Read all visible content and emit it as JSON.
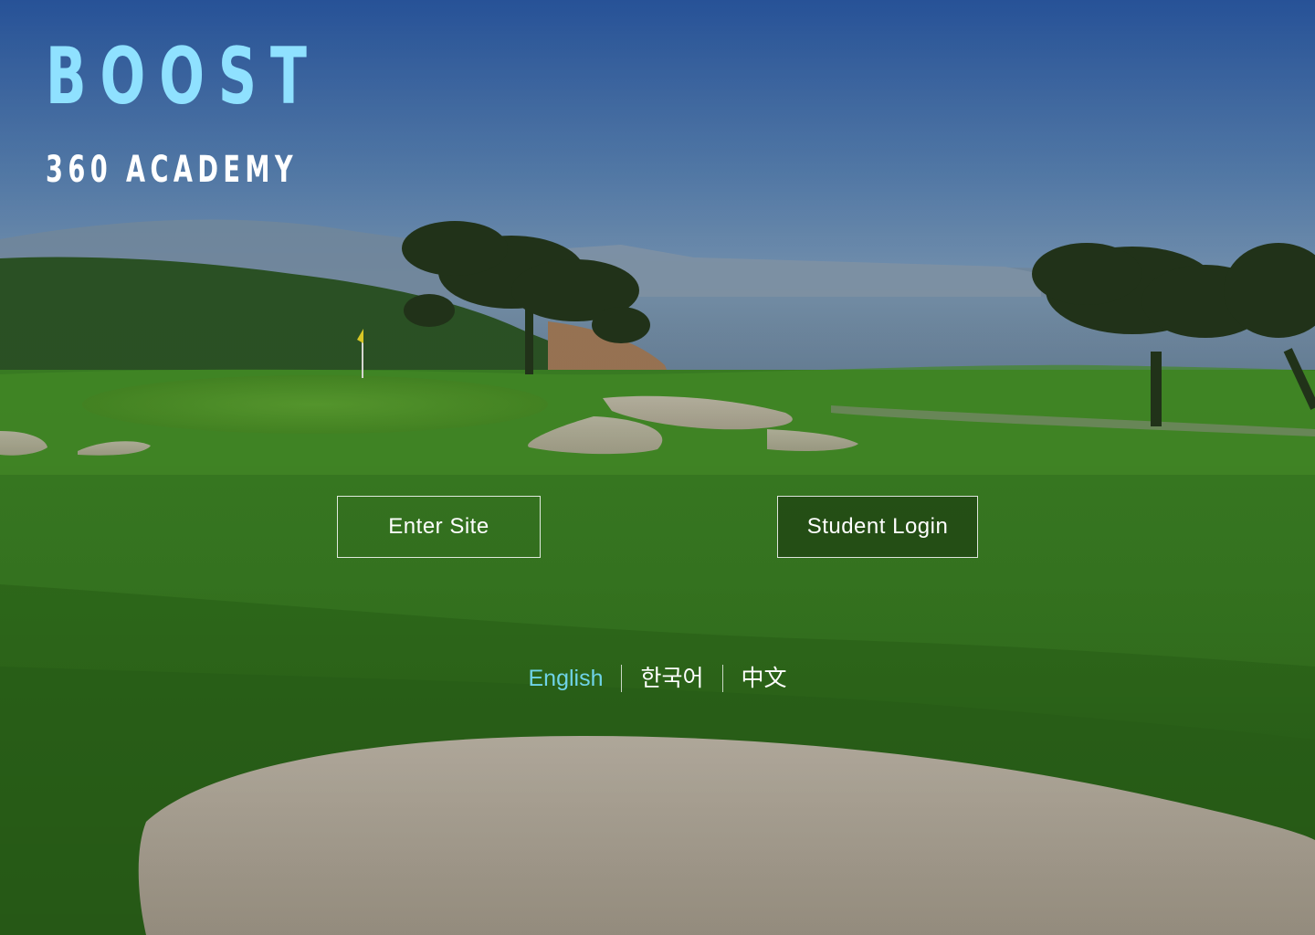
{
  "brand": {
    "title": "BOOST",
    "subtitle": "360 ACADEMY"
  },
  "buttons": {
    "enter_site": "Enter Site",
    "student_login": "Student Login"
  },
  "languages": [
    {
      "label": "English",
      "active": true
    },
    {
      "label": "한국어",
      "active": false
    },
    {
      "label": "中文",
      "active": false
    }
  ],
  "colors": {
    "brand_title": "#8fe1ff",
    "brand_subtitle": "#ffffff",
    "active_language": "#6fd3e8",
    "text": "#ffffff"
  }
}
